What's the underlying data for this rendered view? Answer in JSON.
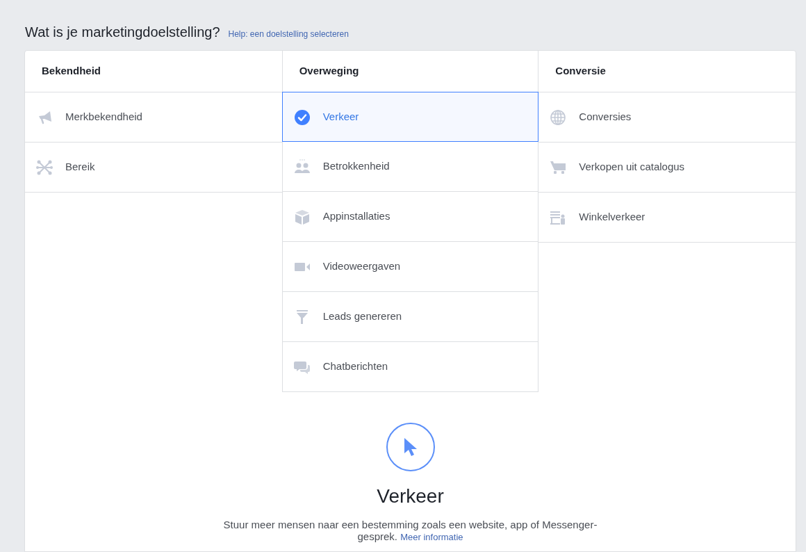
{
  "heading": {
    "title": "Wat is je marketingdoelstelling?",
    "help_link": "Help: een doelstelling selecteren"
  },
  "columns": [
    {
      "title": "Bekendheid",
      "items": [
        {
          "label": "Merkbekendheid",
          "selected": false
        },
        {
          "label": "Bereik",
          "selected": false
        }
      ]
    },
    {
      "title": "Overweging",
      "items": [
        {
          "label": "Verkeer",
          "selected": true
        },
        {
          "label": "Betrokkenheid",
          "selected": false
        },
        {
          "label": "Appinstallaties",
          "selected": false
        },
        {
          "label": "Videoweergaven",
          "selected": false
        },
        {
          "label": "Leads genereren",
          "selected": false
        },
        {
          "label": "Chatberichten",
          "selected": false
        }
      ]
    },
    {
      "title": "Conversie",
      "items": [
        {
          "label": "Conversies",
          "selected": false
        },
        {
          "label": "Verkopen uit catalogus",
          "selected": false
        },
        {
          "label": "Winkelverkeer",
          "selected": false
        }
      ]
    }
  ],
  "detail": {
    "title": "Verkeer",
    "description": "Stuur meer mensen naar een bestemming zoals een website, app of Messenger-gesprek.",
    "link": "Meer informatie"
  }
}
